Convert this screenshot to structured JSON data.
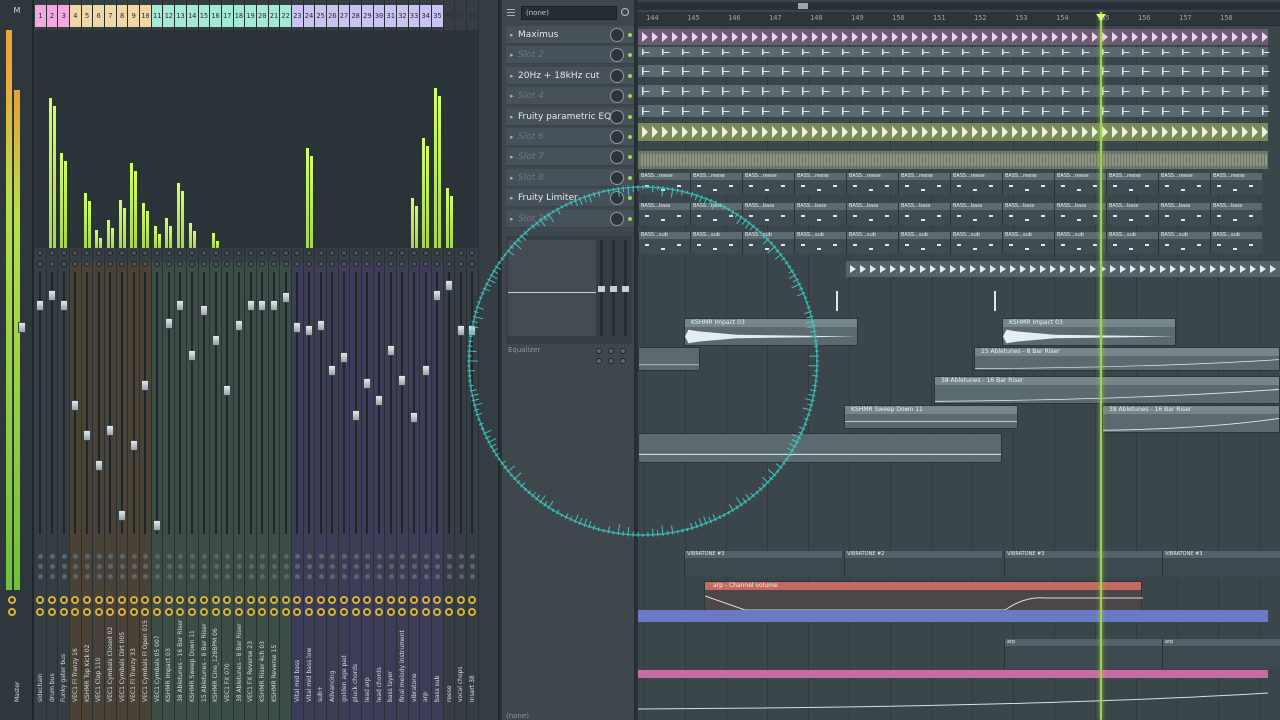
{
  "mixer": {
    "master_label": "M",
    "master_name": "Master",
    "strips": [
      {
        "num": "1",
        "name": "sidechain"
      },
      {
        "num": "2",
        "name": "drum bus"
      },
      {
        "num": "3",
        "name": "Funky gater bus"
      },
      {
        "num": "4",
        "name": "VEC1 Fl Tranzy 16"
      },
      {
        "num": "5",
        "name": "KSHMR Top Kick 02"
      },
      {
        "num": "6",
        "name": "VEC1 Clap 110"
      },
      {
        "num": "7",
        "name": "VEC1 Cymbals Closed 02"
      },
      {
        "num": "8",
        "name": "VEC1 Cymbals Dirt 005"
      },
      {
        "num": "9",
        "name": "VEC1 Fl Tranzy 33"
      },
      {
        "num": "10",
        "name": "VEC1 Cymbals Fl Open 015"
      },
      {
        "num": "11",
        "name": "VEC1 Cymbals 05 007"
      },
      {
        "num": "12",
        "name": "KSHMR Impact 03"
      },
      {
        "num": "13",
        "name": "38 Abletunes - 16 Bar Riser"
      },
      {
        "num": "14",
        "name": "KSHMR Sweep Down 11"
      },
      {
        "num": "15",
        "name": "15 Abletunes - 8 Bar Riser"
      },
      {
        "num": "16",
        "name": "KSHMR Cine_128BPM 06"
      },
      {
        "num": "17",
        "name": "VEC1 FX 070"
      },
      {
        "num": "18",
        "name": "38 Abletunes - 8 Bar Riser"
      },
      {
        "num": "19",
        "name": "VEC1 FX Reverse 23"
      },
      {
        "num": "20",
        "name": "KSHMR Riser 4ch 03"
      },
      {
        "num": "21",
        "name": "KSHMR Reverse 15"
      },
      {
        "num": "22",
        "name": ""
      },
      {
        "num": "23",
        "name": "Vital mid bass"
      },
      {
        "num": "24",
        "name": "Vital mid bass low"
      },
      {
        "num": "25",
        "name": "sub+"
      },
      {
        "num": "26",
        "name": "Advancing"
      },
      {
        "num": "27",
        "name": "golden age pad"
      },
      {
        "num": "28",
        "name": "pluck chords"
      },
      {
        "num": "29",
        "name": "lead arp"
      },
      {
        "num": "30",
        "name": "lead chords"
      },
      {
        "num": "31",
        "name": "bass layer"
      },
      {
        "num": "32",
        "name": "final melody instrument"
      },
      {
        "num": "33",
        "name": "vibratone"
      },
      {
        "num": "34",
        "name": "arp"
      },
      {
        "num": "35",
        "name": "bass sub"
      },
      {
        "num": "36",
        "name": "reese"
      },
      {
        "num": "37",
        "name": "vocal chops"
      },
      {
        "num": "38",
        "name": "Insert 38"
      }
    ]
  },
  "insert": {
    "preset": "(none)",
    "slots": [
      {
        "label": "Maximus",
        "empty": false
      },
      {
        "label": "Slot 2",
        "empty": true
      },
      {
        "label": "20Hz + 18kHz cut",
        "empty": false
      },
      {
        "label": "Slot 4",
        "empty": true
      },
      {
        "label": "Fruity parametric EQ 2",
        "empty": false
      },
      {
        "label": "Slot 6",
        "empty": true
      },
      {
        "label": "Slot 7",
        "empty": true
      },
      {
        "label": "Slot 8",
        "empty": true
      },
      {
        "label": "Fruity Limiter",
        "empty": false
      },
      {
        "label": "Slot 10",
        "empty": true
      }
    ],
    "eq_label": "Equalizer",
    "bottom_label": "(none)"
  },
  "playlist": {
    "bars": [
      "144",
      "145",
      "146",
      "147",
      "148",
      "149",
      "150",
      "151",
      "152",
      "153",
      "154",
      "155",
      "156",
      "157",
      "158"
    ],
    "pattern_labels": {
      "reese": "BASS...reese",
      "bass": "BASS...bass",
      "sub": "BASS...sub"
    },
    "audio_clips": {
      "impact": "KSHMR Impact 03",
      "riser8": "15 Abletunes - 8 Bar Riser",
      "riser16": "38 Abletunes - 16 Bar Riser",
      "sweep": "KSHMR Sweep Down 11"
    },
    "vibratone_clips": [
      "VIBRATONE #3",
      "VIBRATONE #2",
      "VIBRATONE #3",
      "VIBRATONE #3"
    ],
    "automation": "arp - Channel volume",
    "arp_clips": [
      "arp",
      "arp"
    ]
  },
  "colors": {
    "meter": "#c9f25a",
    "playhead": "#9ed24f",
    "visualizer": "#3fd0c8",
    "automation": "#c56a62",
    "blue_track": "#6b78c4",
    "pink_track": "#c86aa6"
  }
}
